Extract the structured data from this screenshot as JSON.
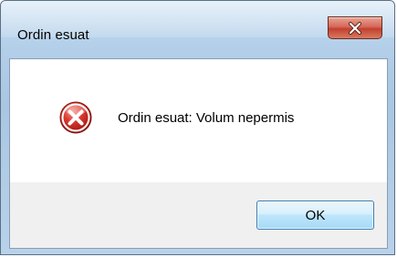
{
  "window": {
    "title": "Ordin esuat"
  },
  "title_bar": {
    "close_icon": "close-x-icon"
  },
  "dialog": {
    "icon": "error-icon",
    "message": "Ordin esuat: Volum nepermis",
    "ok_label": "OK"
  },
  "colors": {
    "error_red": "#d8322a",
    "close_red": "#c94a3a",
    "frame_blue": "#b3cfe9",
    "button_border": "#3c7fb1"
  }
}
